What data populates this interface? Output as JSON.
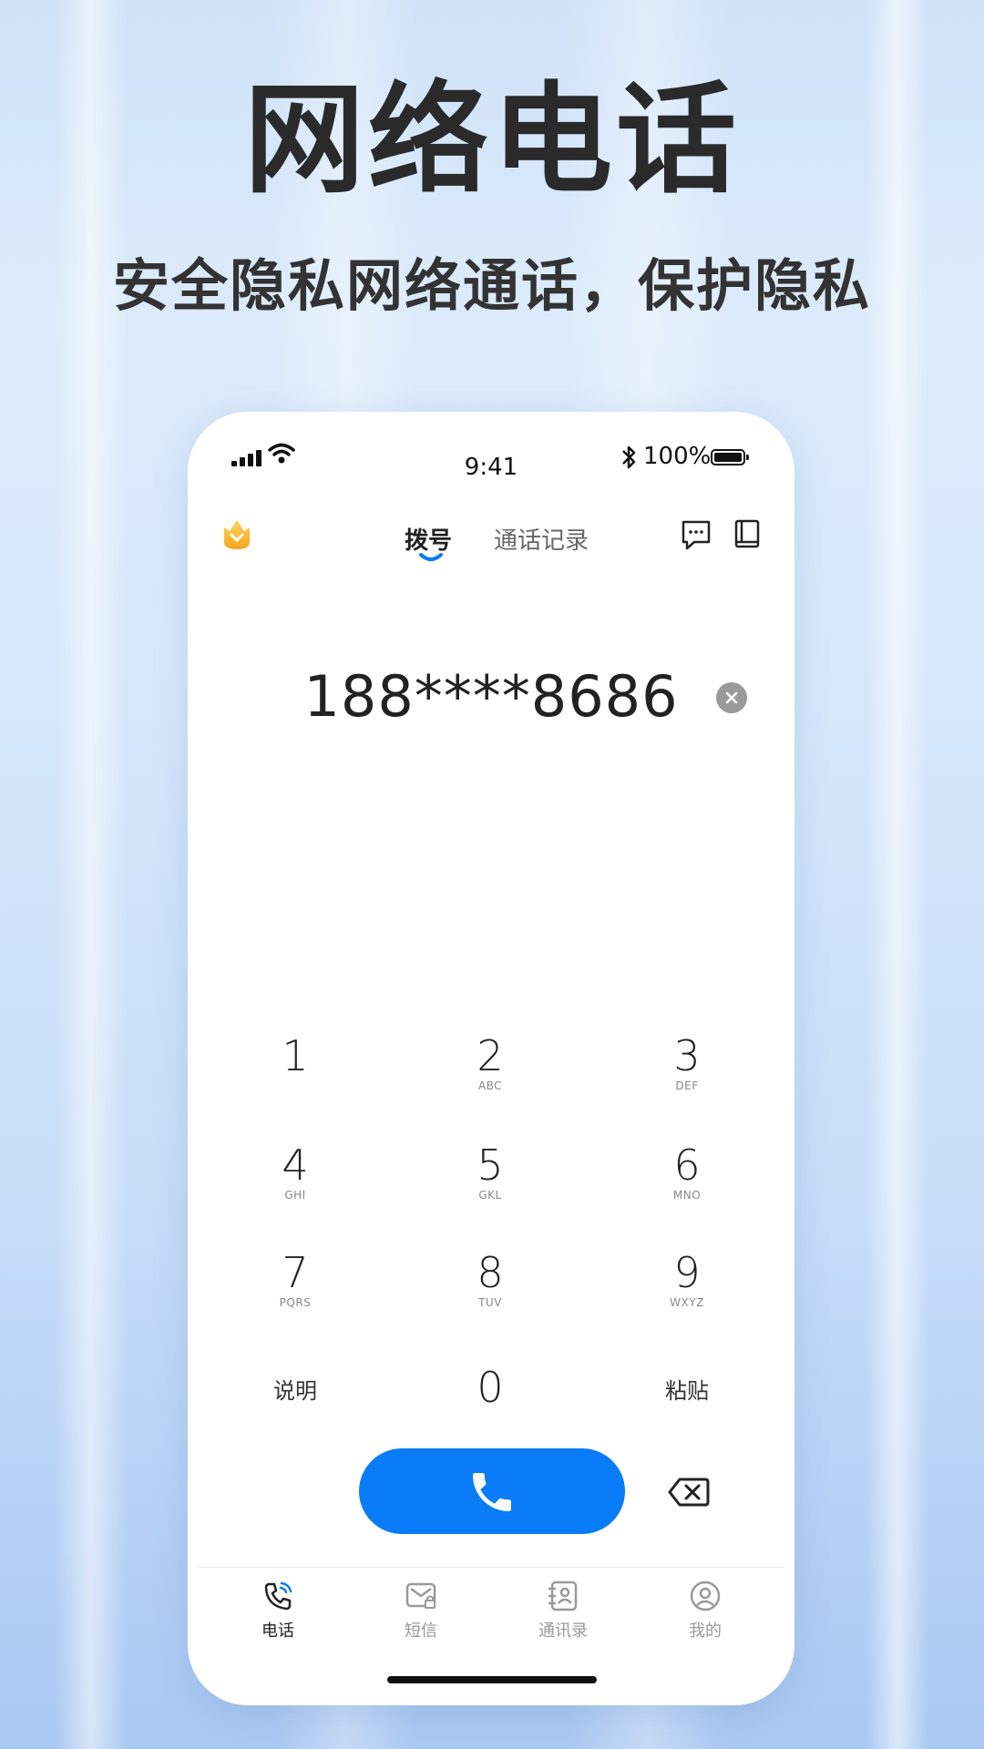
{
  "promo": {
    "headline": "网络电话",
    "subheadline": "安全隐私网络通话，保护隐私"
  },
  "status_bar": {
    "time": "9:41",
    "battery": "100%"
  },
  "top_nav": {
    "tabs": [
      {
        "label": "拨号",
        "active": true
      },
      {
        "label": "通话记录",
        "active": false
      }
    ]
  },
  "dialer": {
    "number": "188****8686",
    "keys": [
      {
        "digit": "1",
        "letters": ""
      },
      {
        "digit": "2",
        "letters": "ABC"
      },
      {
        "digit": "3",
        "letters": "DEF"
      },
      {
        "digit": "4",
        "letters": "GHI"
      },
      {
        "digit": "5",
        "letters": "GKL"
      },
      {
        "digit": "6",
        "letters": "MNO"
      },
      {
        "digit": "7",
        "letters": "PQRS"
      },
      {
        "digit": "8",
        "letters": "TUV"
      },
      {
        "digit": "9",
        "letters": "WXYZ"
      }
    ],
    "left_action": "说明",
    "zero": "0",
    "right_action": "粘贴"
  },
  "bottom_nav": {
    "items": [
      {
        "label": "电话",
        "icon": "phone-icon",
        "active": true
      },
      {
        "label": "短信",
        "icon": "sms-icon",
        "active": false
      },
      {
        "label": "通讯录",
        "icon": "contacts-icon",
        "active": false
      },
      {
        "label": "我的",
        "icon": "profile-icon",
        "active": false
      }
    ]
  },
  "colors": {
    "accent": "#0a7cf7",
    "shield": "#f7b733",
    "text_primary": "#222222",
    "text_muted": "#999999"
  }
}
